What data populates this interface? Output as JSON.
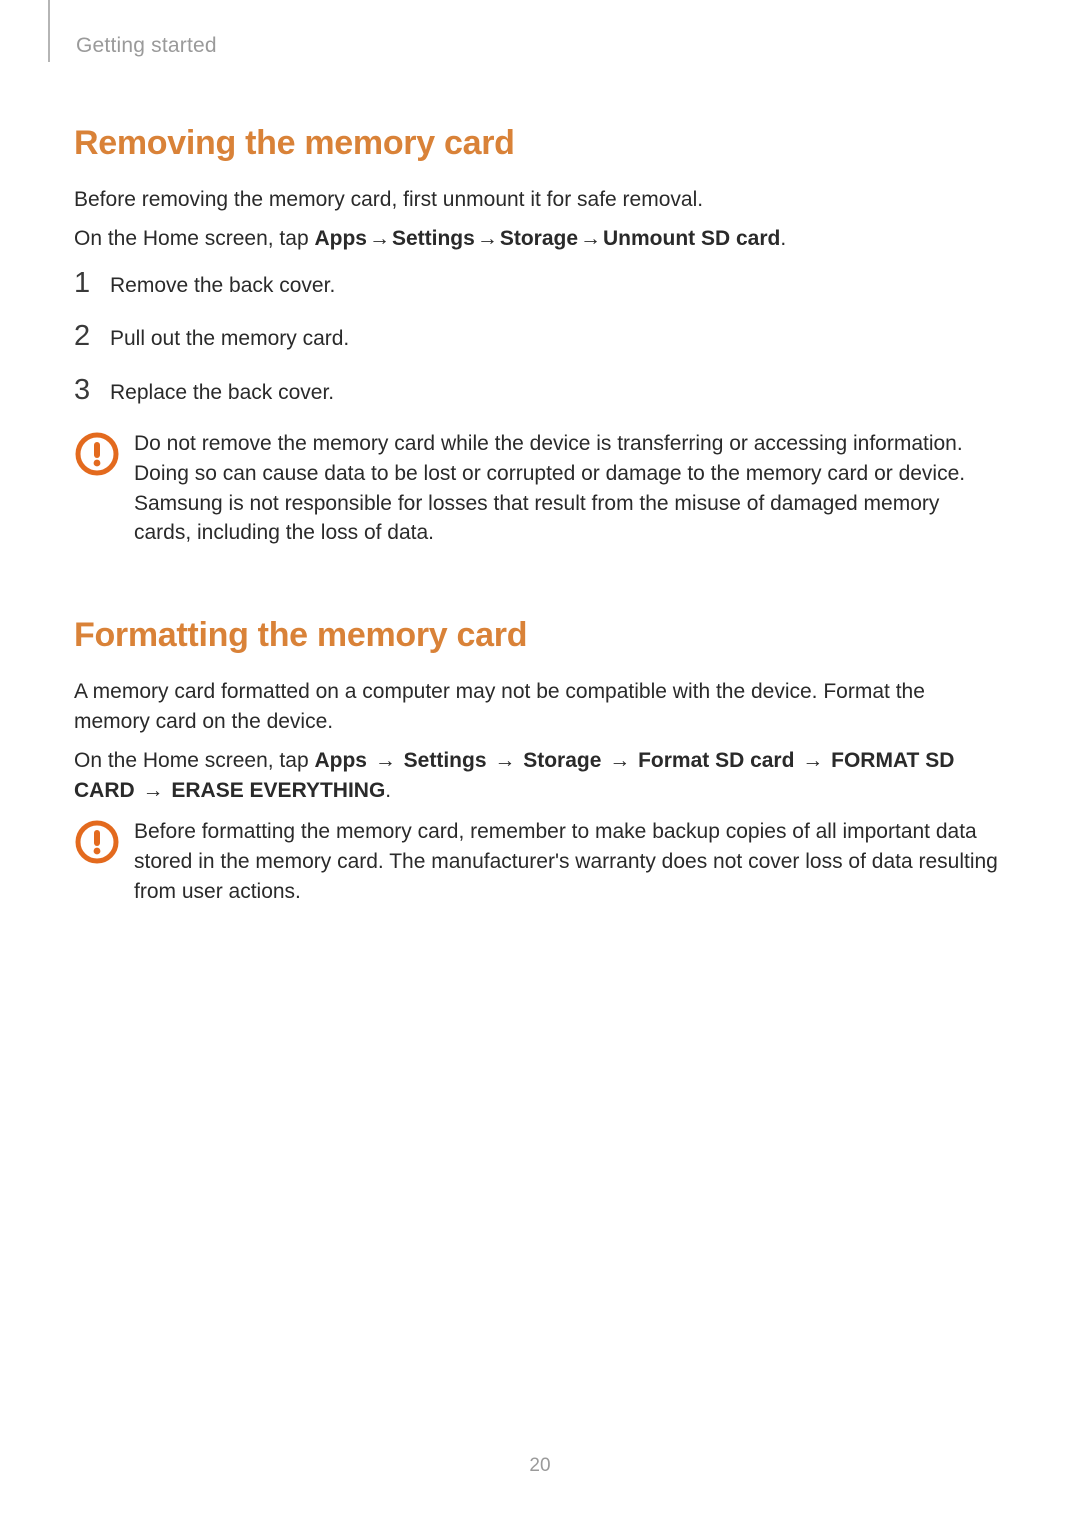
{
  "chapter": "Getting started",
  "page_number": "20",
  "accent_color": "#d98238",
  "arrow_glyph": "→",
  "section1": {
    "heading": "Removing the memory card",
    "intro": "Before removing the memory card, first unmount it for safe removal.",
    "path_prefix": "On the Home screen, tap ",
    "path_steps": [
      "Apps",
      "Settings",
      "Storage",
      "Unmount SD card"
    ],
    "path_suffix": ".",
    "steps": [
      {
        "num": "1",
        "text": "Remove the back cover."
      },
      {
        "num": "2",
        "text": "Pull out the memory card."
      },
      {
        "num": "3",
        "text": "Replace the back cover."
      }
    ],
    "warning": "Do not remove the memory card while the device is transferring or accessing information. Doing so can cause data to be lost or corrupted or damage to the memory card or device. Samsung is not responsible for losses that result from the misuse of damaged memory cards, including the loss of data."
  },
  "section2": {
    "heading": "Formatting the memory card",
    "intro": "A memory card formatted on a computer may not be compatible with the device. Format the memory card on the device.",
    "path_prefix": "On the Home screen, tap ",
    "path_steps": [
      "Apps",
      "Settings",
      "Storage",
      "Format SD card",
      "FORMAT SD CARD",
      "ERASE EVERYTHING"
    ],
    "path_suffix": ".",
    "warning": "Before formatting the memory card, remember to make backup copies of all important data stored in the memory card. The manufacturer's warranty does not cover loss of data resulting from user actions."
  }
}
